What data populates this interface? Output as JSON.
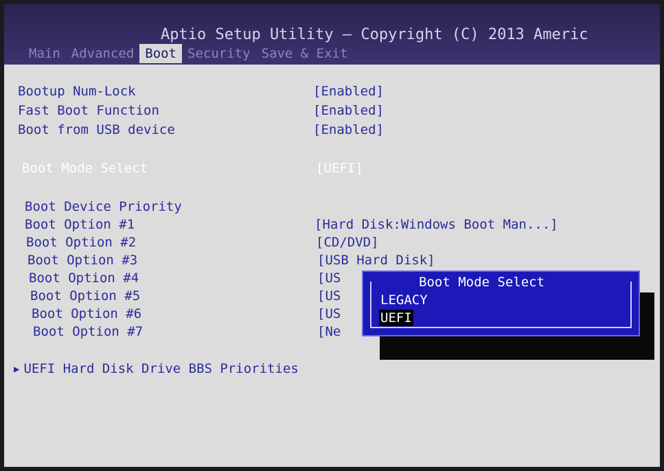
{
  "header": {
    "title": "Aptio Setup Utility – Copyright (C) 2013 Americ",
    "tabs": [
      {
        "label": "Main"
      },
      {
        "label": "Advanced"
      },
      {
        "label": "Boot"
      },
      {
        "label": "Security"
      },
      {
        "label": "Save & Exit"
      }
    ]
  },
  "settings": [
    {
      "label": "Bootup Num-Lock",
      "value": "[Enabled]"
    },
    {
      "label": "Fast Boot Function",
      "value": "[Enabled]"
    },
    {
      "label": "Boot from USB device",
      "value": "[Enabled]"
    },
    {
      "label": "Boot Mode Select",
      "value": "[UEFI]"
    }
  ],
  "priority": {
    "heading": "Boot Device Priority",
    "options": [
      {
        "label": "Boot Option #1",
        "value": "[Hard Disk:Windows Boot Man...]"
      },
      {
        "label": "Boot Option #2",
        "value": "[CD/DVD]"
      },
      {
        "label": "Boot Option #3",
        "value": "[USB Hard Disk]"
      },
      {
        "label": "Boot Option #4",
        "value": "[US"
      },
      {
        "label": "Boot Option #5",
        "value": "[US"
      },
      {
        "label": "Boot Option #6",
        "value": "[US"
      },
      {
        "label": "Boot Option #7",
        "value": "[Ne"
      }
    ]
  },
  "submenu": {
    "label": "UEFI Hard Disk Drive BBS Priorities",
    "icon": "triangle-right-icon"
  },
  "popup": {
    "title": "Boot Mode Select",
    "options": [
      {
        "label": "LEGACY"
      },
      {
        "label": "UEFI"
      }
    ]
  },
  "colors": {
    "header_bg": "#2a2450",
    "body_bg": "#dcdcdc",
    "text": "#2b2c9a",
    "highlight_text": "#ffffff",
    "popup_bg": "#1d18b8"
  }
}
